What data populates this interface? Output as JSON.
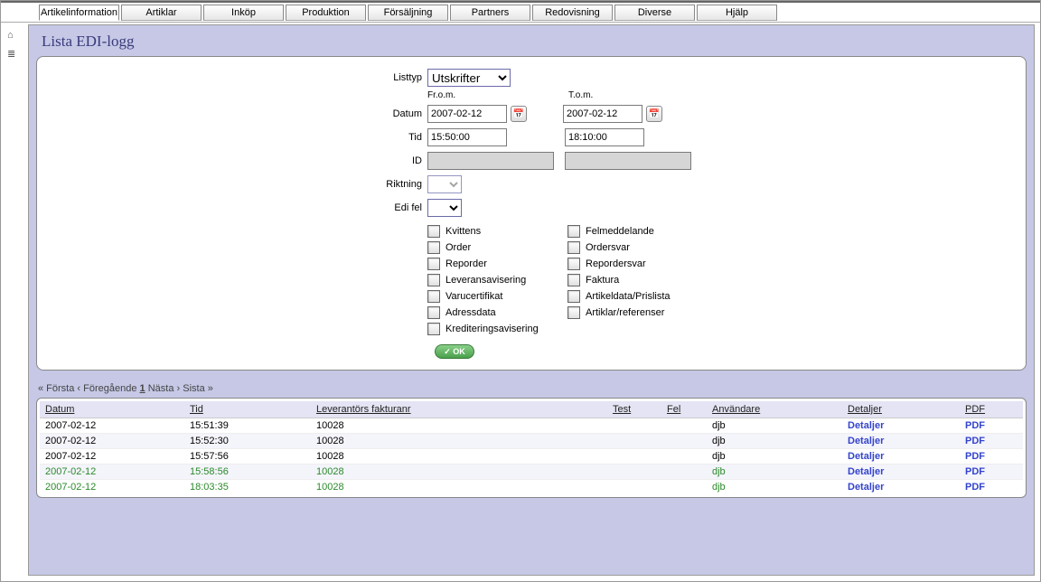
{
  "tabs": [
    "Artikelinformation",
    "Artiklar",
    "Inköp",
    "Produktion",
    "Försäljning",
    "Partners",
    "Redovisning",
    "Diverse",
    "Hjälp"
  ],
  "active_tab": 0,
  "page_title": "Lista EDI-logg",
  "icons": {
    "home": "⌂",
    "bars": "≣",
    "calendar": "📅"
  },
  "form": {
    "listtyp_label": "Listtyp",
    "listtyp_value": "Utskrifter",
    "from_label": "Fr.o.m.",
    "to_label": "T.o.m.",
    "datum_label": "Datum",
    "datum_from": "2007-02-12",
    "datum_to": "2007-02-12",
    "tid_label": "Tid",
    "tid_from": "15:50:00",
    "tid_to": "18:10:00",
    "id_label": "ID",
    "id_from": "",
    "id_to": "",
    "riktning_label": "Riktning",
    "edifel_label": "Edi fel",
    "checkboxes_left": [
      "Kvittens",
      "Order",
      "Reporder",
      "Leveransavisering",
      "Varucertifikat",
      "Adressdata",
      "Krediteringsavisering"
    ],
    "checkboxes_right": [
      "Felmeddelande",
      "Ordersvar",
      "Repordersvar",
      "Faktura",
      "Artikeldata/Prislista",
      "Artiklar/referenser"
    ],
    "ok_label": "OK"
  },
  "pager": {
    "first": "« Första",
    "prev": "‹ Föregående",
    "current": "1",
    "next": "Nästa ›",
    "last": "Sista »"
  },
  "table": {
    "headers": [
      "Datum",
      "Tid",
      "Leverantörs fakturanr",
      "Test",
      "Fel",
      "Användare",
      "Detaljer",
      "PDF"
    ],
    "details_link": "Detaljer",
    "pdf_link": "PDF",
    "rows": [
      {
        "datum": "2007-02-12",
        "tid": "15:51:39",
        "faktnr": "10028",
        "test": "",
        "fel": "",
        "anv": "djb",
        "green": false
      },
      {
        "datum": "2007-02-12",
        "tid": "15:52:30",
        "faktnr": "10028",
        "test": "",
        "fel": "",
        "anv": "djb",
        "green": false
      },
      {
        "datum": "2007-02-12",
        "tid": "15:57:56",
        "faktnr": "10028",
        "test": "",
        "fel": "",
        "anv": "djb",
        "green": false
      },
      {
        "datum": "2007-02-12",
        "tid": "15:58:56",
        "faktnr": "10028",
        "test": "",
        "fel": "",
        "anv": "djb",
        "green": true
      },
      {
        "datum": "2007-02-12",
        "tid": "18:03:35",
        "faktnr": "10028",
        "test": "",
        "fel": "",
        "anv": "djb",
        "green": true
      }
    ]
  }
}
